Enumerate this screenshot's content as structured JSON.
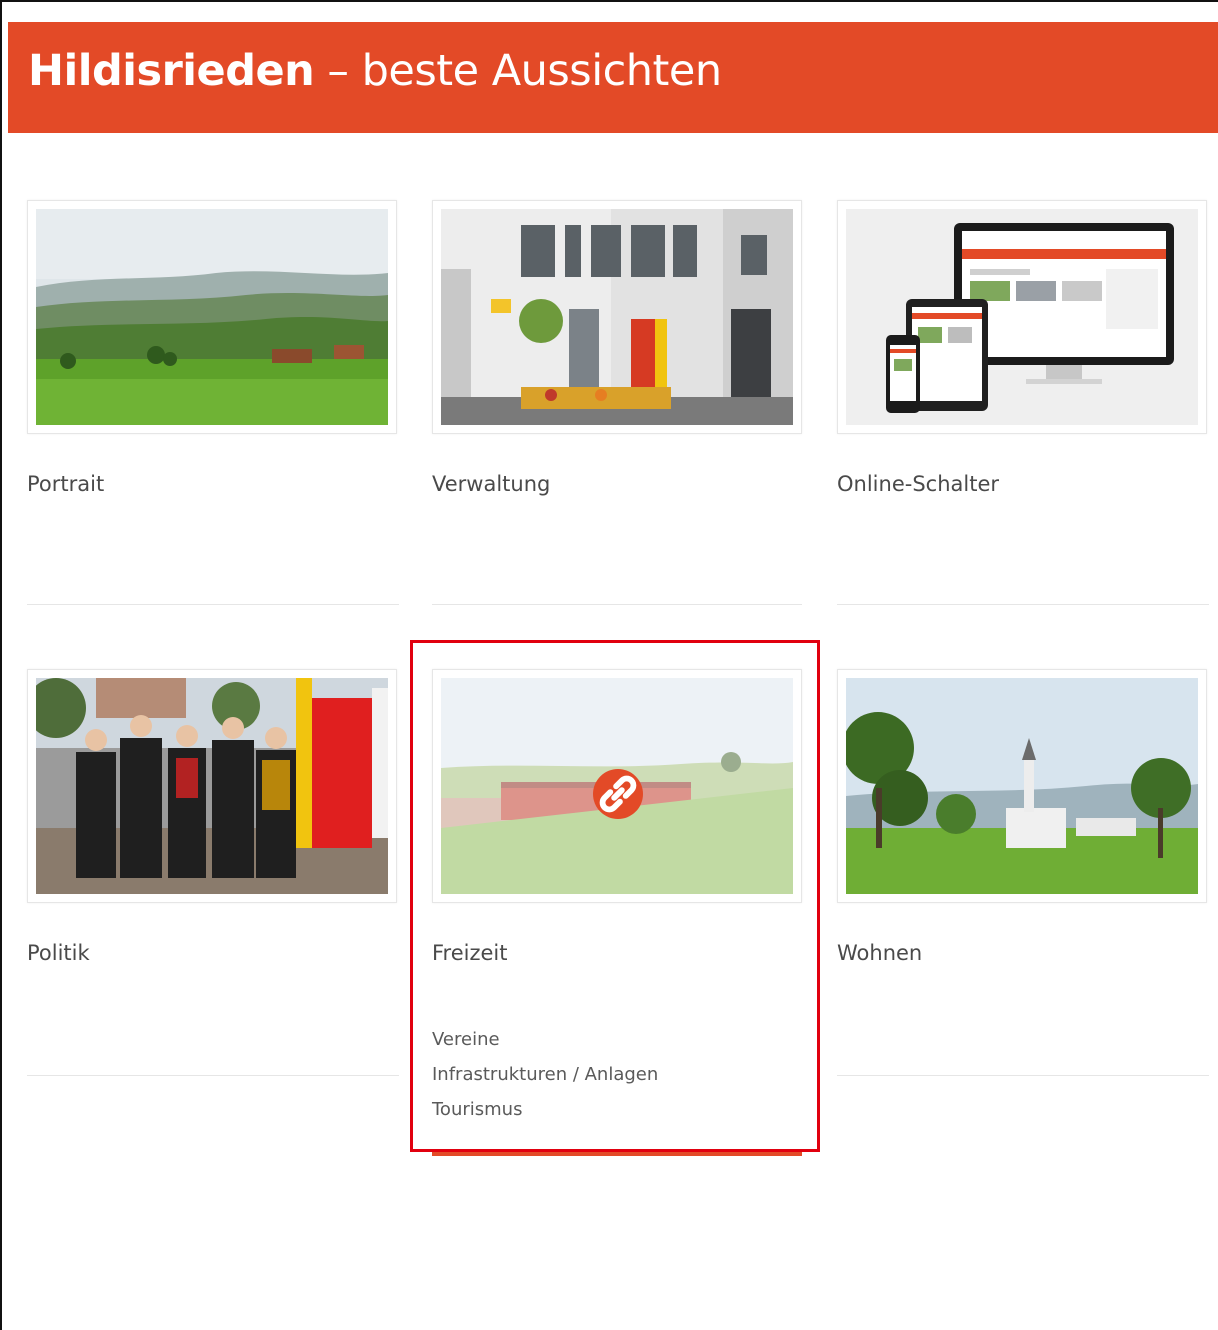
{
  "header": {
    "title_strong": "Hildisrieden",
    "title_rest": " – beste Aussichten"
  },
  "tiles": [
    {
      "label": "Portrait",
      "image": "rolling-green-landscape-photo"
    },
    {
      "label": "Verwaltung",
      "image": "municipal-building-photo"
    },
    {
      "label": "Online-Schalter",
      "image": "responsive-devices-mockup"
    },
    {
      "label": "Politik",
      "image": "council-group-photo"
    },
    {
      "label": "Freizeit",
      "image": "sports-field-photo",
      "hover_icon": "link-icon",
      "sublinks": [
        "Vereine",
        "Infrastrukturen / Anlagen",
        "Tourismus"
      ]
    },
    {
      "label": "Wohnen",
      "image": "village-church-photo"
    }
  ],
  "colors": {
    "accent": "#e34a27",
    "highlight_box": "#e1000f",
    "text": "#4a4a4a"
  }
}
